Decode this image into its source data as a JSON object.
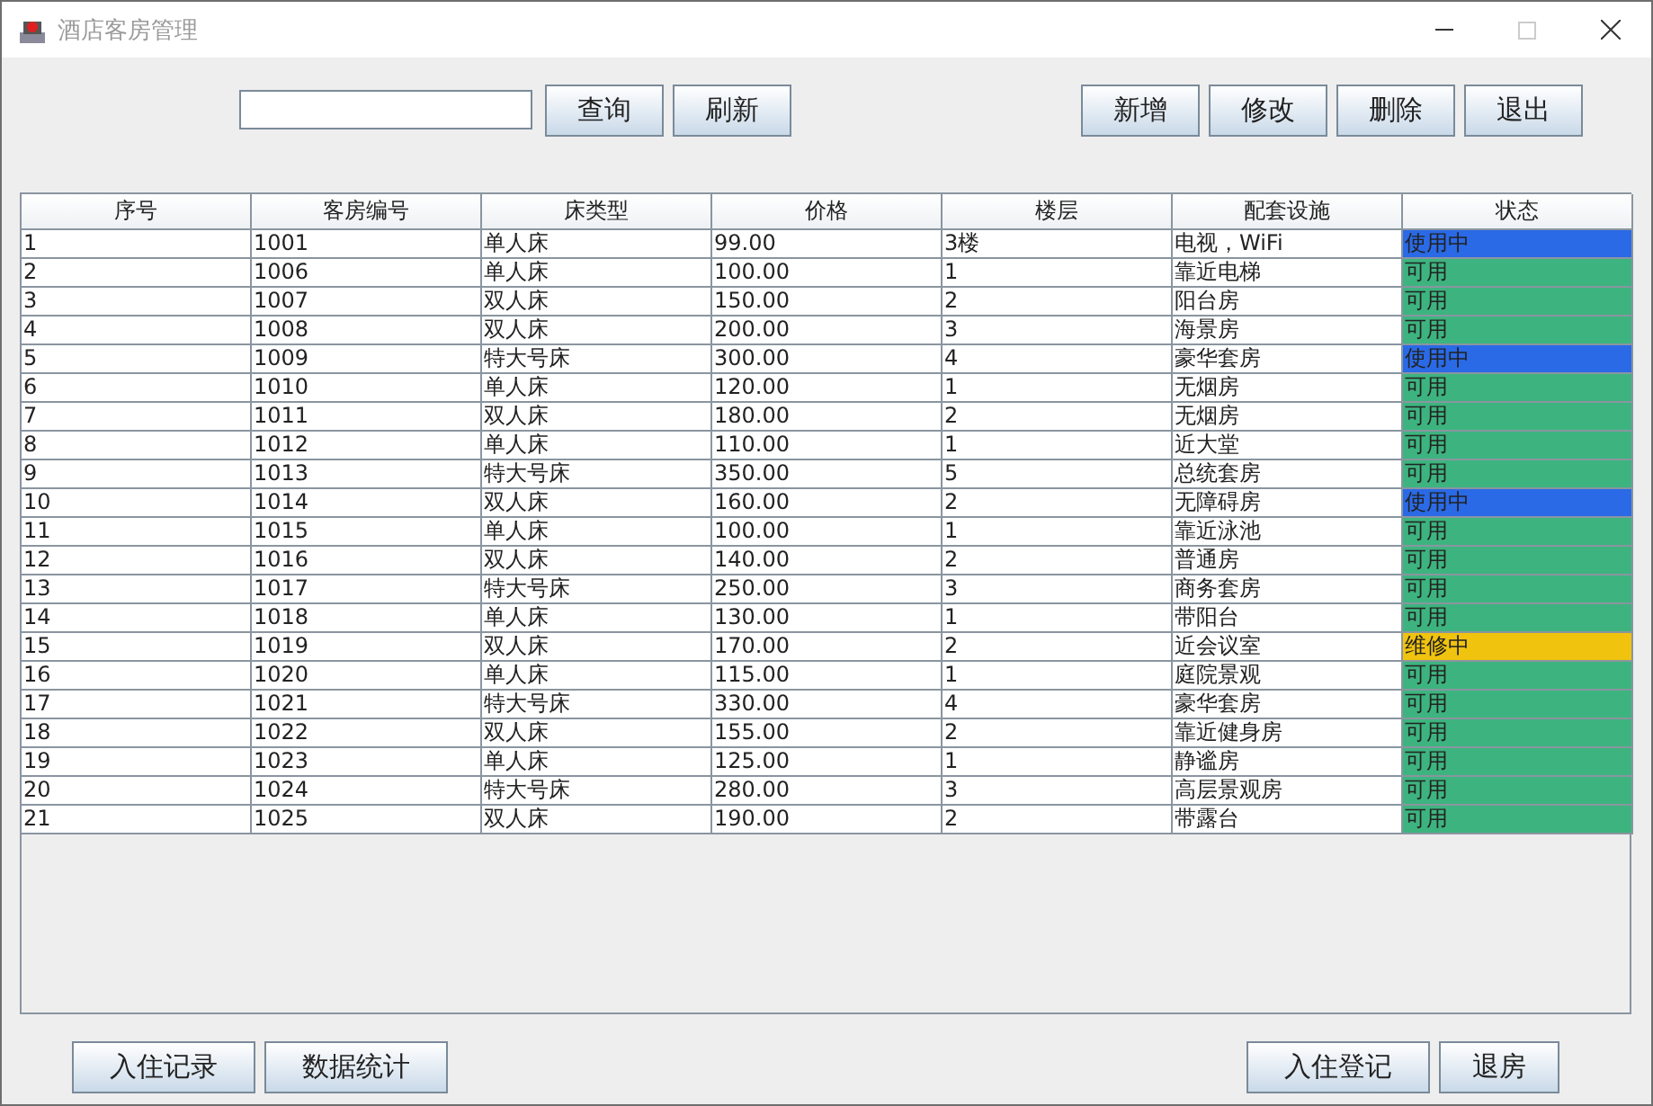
{
  "window": {
    "title": "酒店客房管理",
    "controls": [
      {
        "kind": "minimize",
        "disabled": false
      },
      {
        "kind": "maximize",
        "disabled": true
      },
      {
        "kind": "close",
        "disabled": false
      }
    ]
  },
  "toolbar": {
    "left_buttons": [
      "查询",
      "刷新"
    ],
    "right_buttons": [
      "新增",
      "修改",
      "删除",
      "退出"
    ]
  },
  "table": {
    "columns": [
      "序号",
      "客房编号",
      "床类型",
      "价格",
      "楼层",
      "配套设施",
      "状态"
    ],
    "rows": [
      {
        "cells": [
          "1",
          "1001",
          "单人床",
          "99.00",
          "3楼",
          "电视，WiFi"
        ],
        "status": "使用中",
        "color": "#2a6ae6"
      },
      {
        "cells": [
          "2",
          "1006",
          "单人床",
          "100.00",
          "1",
          "靠近电梯"
        ],
        "status": "可用",
        "color": "#3db47f"
      },
      {
        "cells": [
          "3",
          "1007",
          "双人床",
          "150.00",
          "2",
          "阳台房"
        ],
        "status": "可用",
        "color": "#3db47f"
      },
      {
        "cells": [
          "4",
          "1008",
          "双人床",
          "200.00",
          "3",
          "海景房"
        ],
        "status": "可用",
        "color": "#3db47f"
      },
      {
        "cells": [
          "5",
          "1009",
          "特大号床",
          "300.00",
          "4",
          "豪华套房"
        ],
        "status": "使用中",
        "color": "#2a6ae6"
      },
      {
        "cells": [
          "6",
          "1010",
          "单人床",
          "120.00",
          "1",
          "无烟房"
        ],
        "status": "可用",
        "color": "#3db47f"
      },
      {
        "cells": [
          "7",
          "1011",
          "双人床",
          "180.00",
          "2",
          "无烟房"
        ],
        "status": "可用",
        "color": "#3db47f"
      },
      {
        "cells": [
          "8",
          "1012",
          "单人床",
          "110.00",
          "1",
          "近大堂"
        ],
        "status": "可用",
        "color": "#3db47f"
      },
      {
        "cells": [
          "9",
          "1013",
          "特大号床",
          "350.00",
          "5",
          "总统套房"
        ],
        "status": "可用",
        "color": "#3db47f"
      },
      {
        "cells": [
          "10",
          "1014",
          "双人床",
          "160.00",
          "2",
          "无障碍房"
        ],
        "status": "使用中",
        "color": "#2a6ae6"
      },
      {
        "cells": [
          "11",
          "1015",
          "单人床",
          "100.00",
          "1",
          "靠近泳池"
        ],
        "status": "可用",
        "color": "#3db47f"
      },
      {
        "cells": [
          "12",
          "1016",
          "双人床",
          "140.00",
          "2",
          "普通房"
        ],
        "status": "可用",
        "color": "#3db47f"
      },
      {
        "cells": [
          "13",
          "1017",
          "特大号床",
          "250.00",
          "3",
          "商务套房"
        ],
        "status": "可用",
        "color": "#3db47f"
      },
      {
        "cells": [
          "14",
          "1018",
          "单人床",
          "130.00",
          "1",
          "带阳台"
        ],
        "status": "可用",
        "color": "#3db47f"
      },
      {
        "cells": [
          "15",
          "1019",
          "双人床",
          "170.00",
          "2",
          "近会议室"
        ],
        "status": "维修中",
        "color": "#f0c30f"
      },
      {
        "cells": [
          "16",
          "1020",
          "单人床",
          "115.00",
          "1",
          "庭院景观"
        ],
        "status": "可用",
        "color": "#3db47f"
      },
      {
        "cells": [
          "17",
          "1021",
          "特大号床",
          "330.00",
          "4",
          "豪华套房"
        ],
        "status": "可用",
        "color": "#3db47f"
      },
      {
        "cells": [
          "18",
          "1022",
          "双人床",
          "155.00",
          "2",
          "靠近健身房"
        ],
        "status": "可用",
        "color": "#3db47f"
      },
      {
        "cells": [
          "19",
          "1023",
          "单人床",
          "125.00",
          "1",
          "静谧房"
        ],
        "status": "可用",
        "color": "#3db47f"
      },
      {
        "cells": [
          "20",
          "1024",
          "特大号床",
          "280.00",
          "3",
          "高层景观房"
        ],
        "status": "可用",
        "color": "#3db47f"
      },
      {
        "cells": [
          "21",
          "1025",
          "双人床",
          "190.00",
          "2",
          "带露台"
        ],
        "status": "可用",
        "color": "#3db47f"
      }
    ]
  },
  "footer": {
    "left_buttons": [
      "入住记录",
      "数据统计"
    ],
    "right_buttons": [
      "入住登记",
      "退房"
    ]
  }
}
